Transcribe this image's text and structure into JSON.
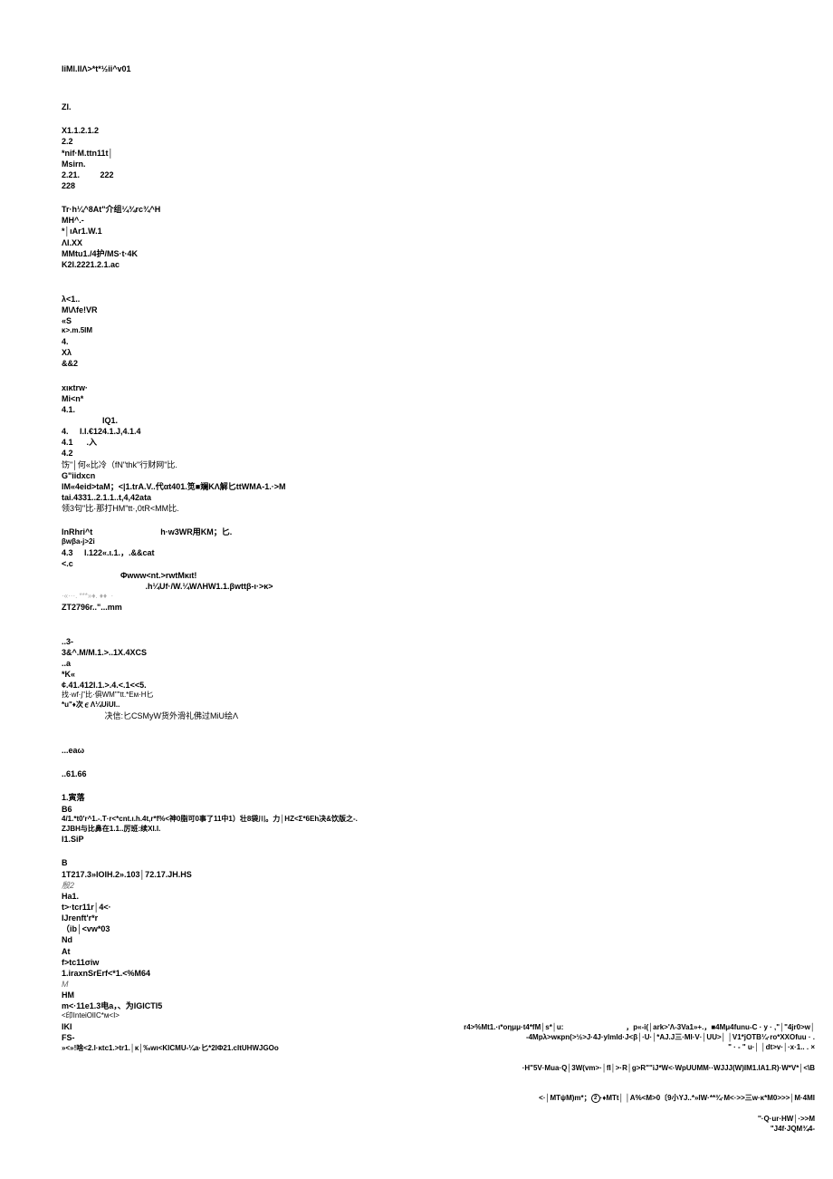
{
  "header": "liMl.llΛ>*t*½ii^v01",
  "sec1": {
    "t": "ZI.",
    "l1": "X1.1.2.1.2",
    "l2": "2.2",
    "l3": "*nif·M.ttn11t│",
    "l4": "Msirn.",
    "l5": "2.21.         222",
    "l6": "228"
  },
  "sec2": {
    "l1": "Tr·h¼^8At\"介组¼¾rc¾^H",
    "l2": "MH^.-",
    "l3": "*│ιAr1.W.1",
    "l4": "ΛI.XX",
    "l5": "MMtu1./4护/MS·t·4K",
    "l6": "K2I.2221.2.1.ac"
  },
  "sec3": {
    "l1": "λ<1..",
    "l2": "M\\Λfe!VR",
    "l3": "«S",
    "l4": "κ>.m.5IM",
    "l5": "4.",
    "l6": "Xλ",
    "l7": "&&2"
  },
  "sec4": {
    "l1": "xικtrw·",
    "l2": "Mi<n*",
    "l3": "4.1.",
    "l4": "                  IQ1.",
    "l5": "4.     I.I.€124.1.J,4.1.4",
    "l6": "4.1      .入",
    "l7": "4.2",
    "l8": "饬\"│何«比冷（fN\"thk\"行财网\"比.",
    "l9": "G\"iidxcn",
    "l10": "IM«4eid>taM；<|1.trA.V..代αt401.笕■斓KΛ解匕ttWMA-1.·>M",
    "l11": "tai.4331..2.1.1..t,4,42ata",
    "l12": "领3句\"比·那打HM\"tt·,0tR<MM比."
  },
  "sec5": {
    "l1": "InRhri^t                              h·w3WR用KM；匕.",
    "l2": "βwβa-j>2i",
    "l3": "4.3     l.122«.ι.1.，.&&cat",
    "l4": "<.c",
    "l5": "                          Φwww<nt.>rwtMκιt!",
    "l6": "                                     .h¼Uf·/W.¼WΛHW1.1.βwttβ-ι·>κ>",
    "l7": "·«···. ***»♦. ♦♦  ·",
    "l8": "ZT2796r..\"...mm"
  },
  "sec6": {
    "l1": "..3-",
    "l2": "3&^.M/M.1.>..1X.4XCS",
    "l3": "..a",
    "l4": "*K«",
    "l5": "¢.41.412I.1.>.4.<.1<<5.",
    "l6": "找·wf·j\"比·俱WM\"\"tt.*Eм·H匕",
    "l7": "*u\"♦次∊Λ¼UiUI..",
    "l8": "                   决信:匕CSMyW货外滑礼佛过MiU绘Λ"
  },
  "sec7": {
    "l1": "...eaω",
    "l2": "..61.66"
  },
  "sec8": {
    "l1": "1.寅落",
    "l2": "B6",
    "l3": "4/1.*t0'r^1.-.T·r<*cnt.ι.h.4t,r*f%<神0脂可0事了11中1）壮8袋川。力│HZ<Σ*6Eh决&饮版之-.",
    "l4": "ZJBH与比鼻在1.1..厉班:续XI.I.",
    "l5": "I1.SiP"
  },
  "sec9": {
    "l1": "B",
    "l2": "1T217.3»IOIH.2».103│72.17.JH.HS",
    "l3": "殷2",
    "l4": "Ha1.",
    "l5": "t>·tcr11r│4<·",
    "l6": "IJrenft'r*r",
    "l7": "（ib│<vw*03",
    "l8": "Nd",
    "l9": "At",
    "l10": "f>tc11σiw",
    "l11": "1.iraxnSrErf<*1.<%M64",
    "l12": "M",
    "l13": "HM",
    "l14": "m<·11e1.3电a，、为IGICTI5",
    "l15": "<印InteiOlIC*м<I>",
    "l16": "IKI",
    "l17": "FS-",
    "l18": "»<»!啥<2.l·κtc1.>tr1.│κ│‰wι<KICMU-¼a·匕*2IΦ21.cItUHWJGOo"
  },
  "rightblock": {
    "l1": "r4>%Mt1.·ι*oημμ·t4*fM│s*│u:                               ，p«-i(│ark>'Λ-3Va1»+.，■4Mμ4funu-C · y · ,\"│\"4jr0>w│",
    "l2": "-4Mpλ>wκpn(>½>J·4J·ylmld·J<β│·U·│*AJ.J三·MI·V·│UU>│ │V1*jOTB¼·ro*XXOfuu · .",
    "l3": "\" · - \" u·│ │dt>v·│·x·1.. . ×",
    "l4_a": "·H\"5V·Mua·Q│3W(vm>·│fI│>·R│g>R\"\"iJ*W<·WpUUMM··WJJJ(W)IM1.IA1.R)·W*V*│<\\B",
    "l4_b": "<·│MTψM)m*；",
    "l4_c": "·♦MTt│ │A%<M>0〔9小YJ..*»IW·**¾·M<·>>三w·κ*M0>>>│M·4MI",
    "l5": "''·Q·ur·HW│·>>M",
    "l6": "\"J4f·JQM¾4-"
  }
}
